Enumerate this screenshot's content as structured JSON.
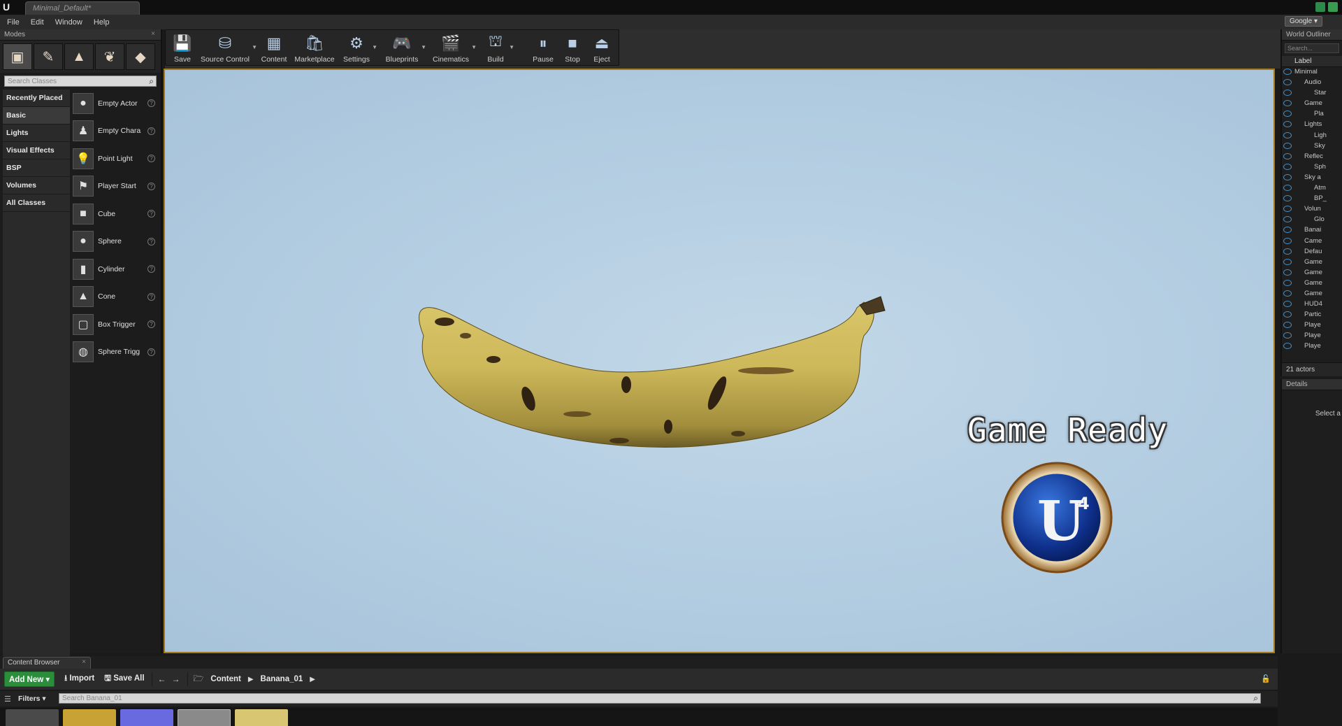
{
  "titlebar": {
    "doc_tab": "Minimal_Default*"
  },
  "menu": [
    "File",
    "Edit",
    "Window",
    "Help"
  ],
  "menu_right": {
    "google": "Google ▾"
  },
  "modes_panel": {
    "tab": "Modes",
    "search_placeholder": "Search Classes",
    "categories": [
      "Recently Placed",
      "Basic",
      "Lights",
      "Visual Effects",
      "BSP",
      "Volumes",
      "All Classes"
    ],
    "active_category": "Basic",
    "classes": [
      "Empty Actor",
      "Empty Chara",
      "Point Light",
      "Player Start",
      "Cube",
      "Sphere",
      "Cylinder",
      "Cone",
      "Box Trigger",
      "Sphere Trigg"
    ]
  },
  "toolbar": {
    "buttons": [
      {
        "label": "Save",
        "icon": "save-icon"
      },
      {
        "label": "Source Control",
        "icon": "source-control-icon"
      },
      {
        "label": "Content",
        "icon": "content-icon"
      },
      {
        "label": "Marketplace",
        "icon": "marketplace-icon"
      },
      {
        "label": "Settings",
        "icon": "settings-icon"
      },
      {
        "label": "Blueprints",
        "icon": "blueprints-icon"
      },
      {
        "label": "Cinematics",
        "icon": "cinematics-icon"
      },
      {
        "label": "Build",
        "icon": "build-icon"
      },
      {
        "label": "Pause",
        "icon": "pause-icon"
      },
      {
        "label": "Stop",
        "icon": "stop-icon"
      },
      {
        "label": "Eject",
        "icon": "eject-icon"
      }
    ]
  },
  "viewport": {
    "overlay_text": "Game Ready",
    "logo_text": "U4",
    "accent_color": "#a57a1a"
  },
  "world_outliner": {
    "tab": "World Outliner",
    "search_placeholder": "Search...",
    "column": "Label",
    "rows": [
      "Minimal",
      "Audio",
      "Star",
      "Game",
      "Pla",
      "Lights",
      "Ligh",
      "Sky",
      "Reflec",
      "Sph",
      "Sky a",
      "Atm",
      "BP_",
      "Volun",
      "Glo",
      "Banai",
      "Came",
      "Defau",
      "Game",
      "Game",
      "Game",
      "Game",
      "HUD4",
      "Partic",
      "Playe",
      "Playe",
      "Playe"
    ],
    "actor_count": "21 actors"
  },
  "details": {
    "tab": "Details",
    "hint": "Select a"
  },
  "content_browser": {
    "tab": "Content Browser",
    "add_new": "Add New ▾",
    "import": "Import",
    "save_all": "Save All",
    "breadcrumb": [
      "Content",
      "Banana_01"
    ],
    "filters": "Filters ▾",
    "search_placeholder": "Search Banana_01"
  }
}
